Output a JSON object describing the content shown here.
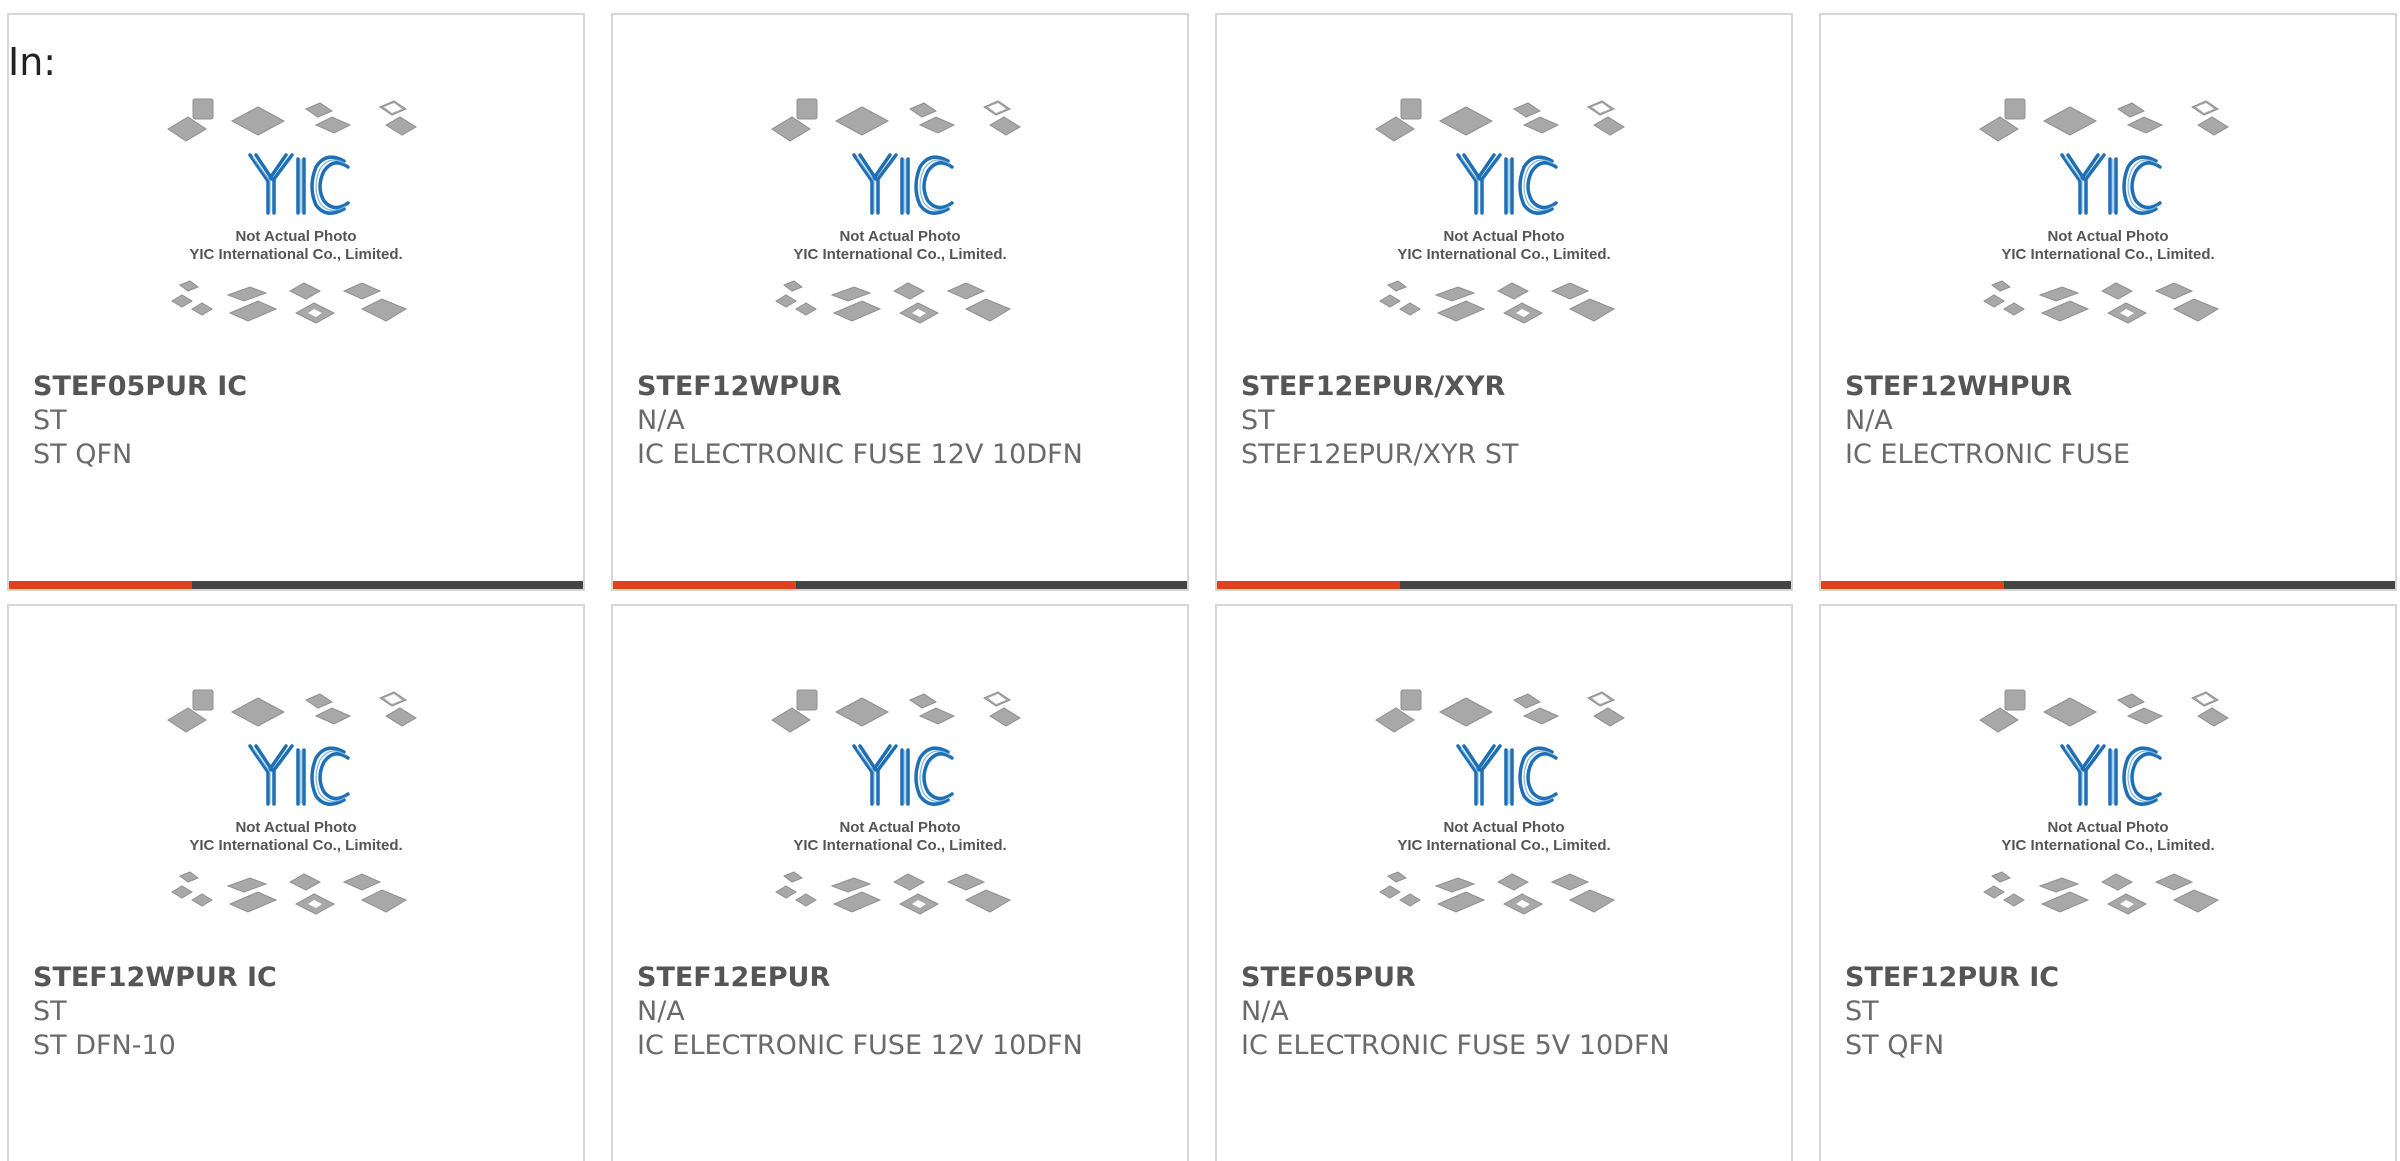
{
  "header": {
    "label": "In:"
  },
  "thumbnail": {
    "line1": "Not Actual Photo",
    "line2": "YIC International Co., Limited.",
    "logo_text": "YIC",
    "logo_color": "#1e6fb5"
  },
  "colors": {
    "accent": "#e0401c",
    "bar": "#444444"
  },
  "products": [
    {
      "part": "STEF05PUR IC",
      "maker": "ST",
      "desc": "ST QFN"
    },
    {
      "part": "STEF12WPUR",
      "maker": "N/A",
      "desc": "IC ELECTRONIC FUSE 12V 10DFN"
    },
    {
      "part": "STEF12EPUR/XYR",
      "maker": "ST",
      "desc": "STEF12EPUR/XYR ST"
    },
    {
      "part": "STEF12WHPUR",
      "maker": "N/A",
      "desc": "IC ELECTRONIC FUSE"
    },
    {
      "part": "STEF12WPUR IC",
      "maker": "ST",
      "desc": "ST DFN-10"
    },
    {
      "part": "STEF12EPUR",
      "maker": "N/A",
      "desc": "IC ELECTRONIC FUSE 12V 10DFN"
    },
    {
      "part": "STEF05PUR",
      "maker": "N/A",
      "desc": "IC ELECTRONIC FUSE 5V 10DFN"
    },
    {
      "part": "STEF12PUR IC",
      "maker": "ST",
      "desc": "ST QFN"
    }
  ]
}
